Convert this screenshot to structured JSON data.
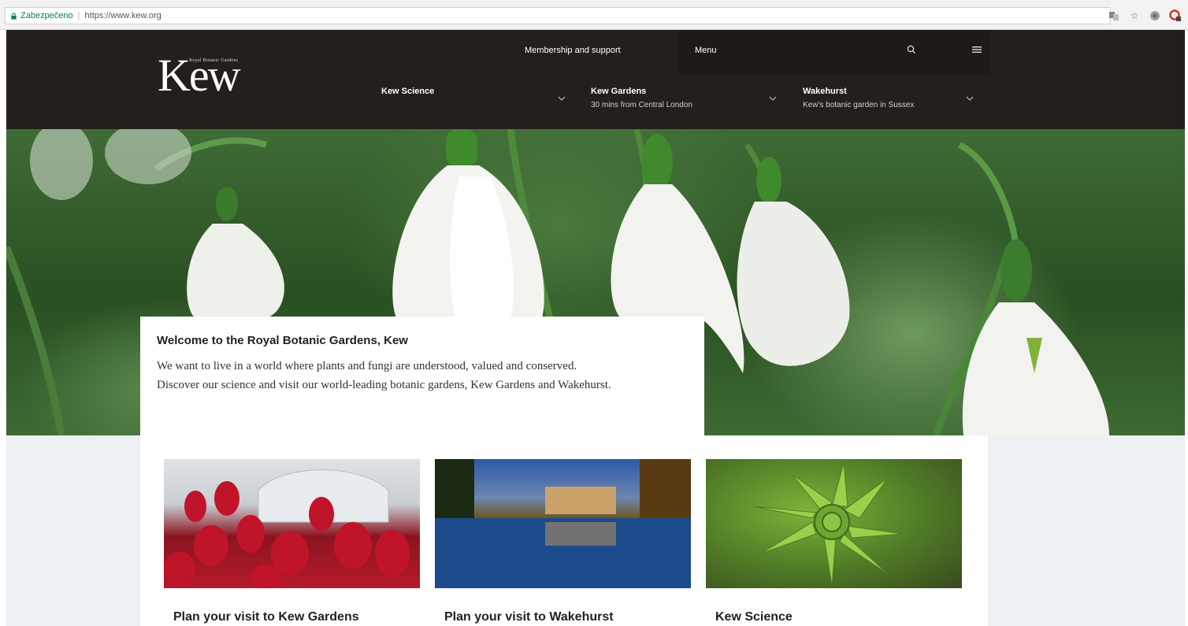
{
  "browser": {
    "secure_label": "Zabezpečeno",
    "url": "https://www.kew.org"
  },
  "header": {
    "logo_text": "Kew",
    "logo_small_text": "Royal Botanic Gardens",
    "top_links": [
      "Membership and support"
    ],
    "menu_label": "Menu",
    "nav": [
      {
        "title": "Kew Science",
        "subtitle": ""
      },
      {
        "title": "Kew Gardens",
        "subtitle": "30 mins from Central London"
      },
      {
        "title": "Wakehurst",
        "subtitle": "Kew's botanic garden in Sussex"
      }
    ]
  },
  "welcome": {
    "title": "Welcome to the Royal Botanic Gardens, Kew",
    "body": "We want to live in a world where plants and fungi are understood, valued and conserved. Discover our science and visit our world-leading botanic gardens, Kew Gardens and Wakehurst."
  },
  "cards": [
    {
      "title": "Plan your visit to Kew Gardens"
    },
    {
      "title": "Plan your visit to Wakehurst"
    },
    {
      "title": "Kew Science"
    }
  ],
  "colors": {
    "header_bg": "#231f1c",
    "menu_bg": "#1d1a18",
    "secure_green": "#0b8043"
  }
}
